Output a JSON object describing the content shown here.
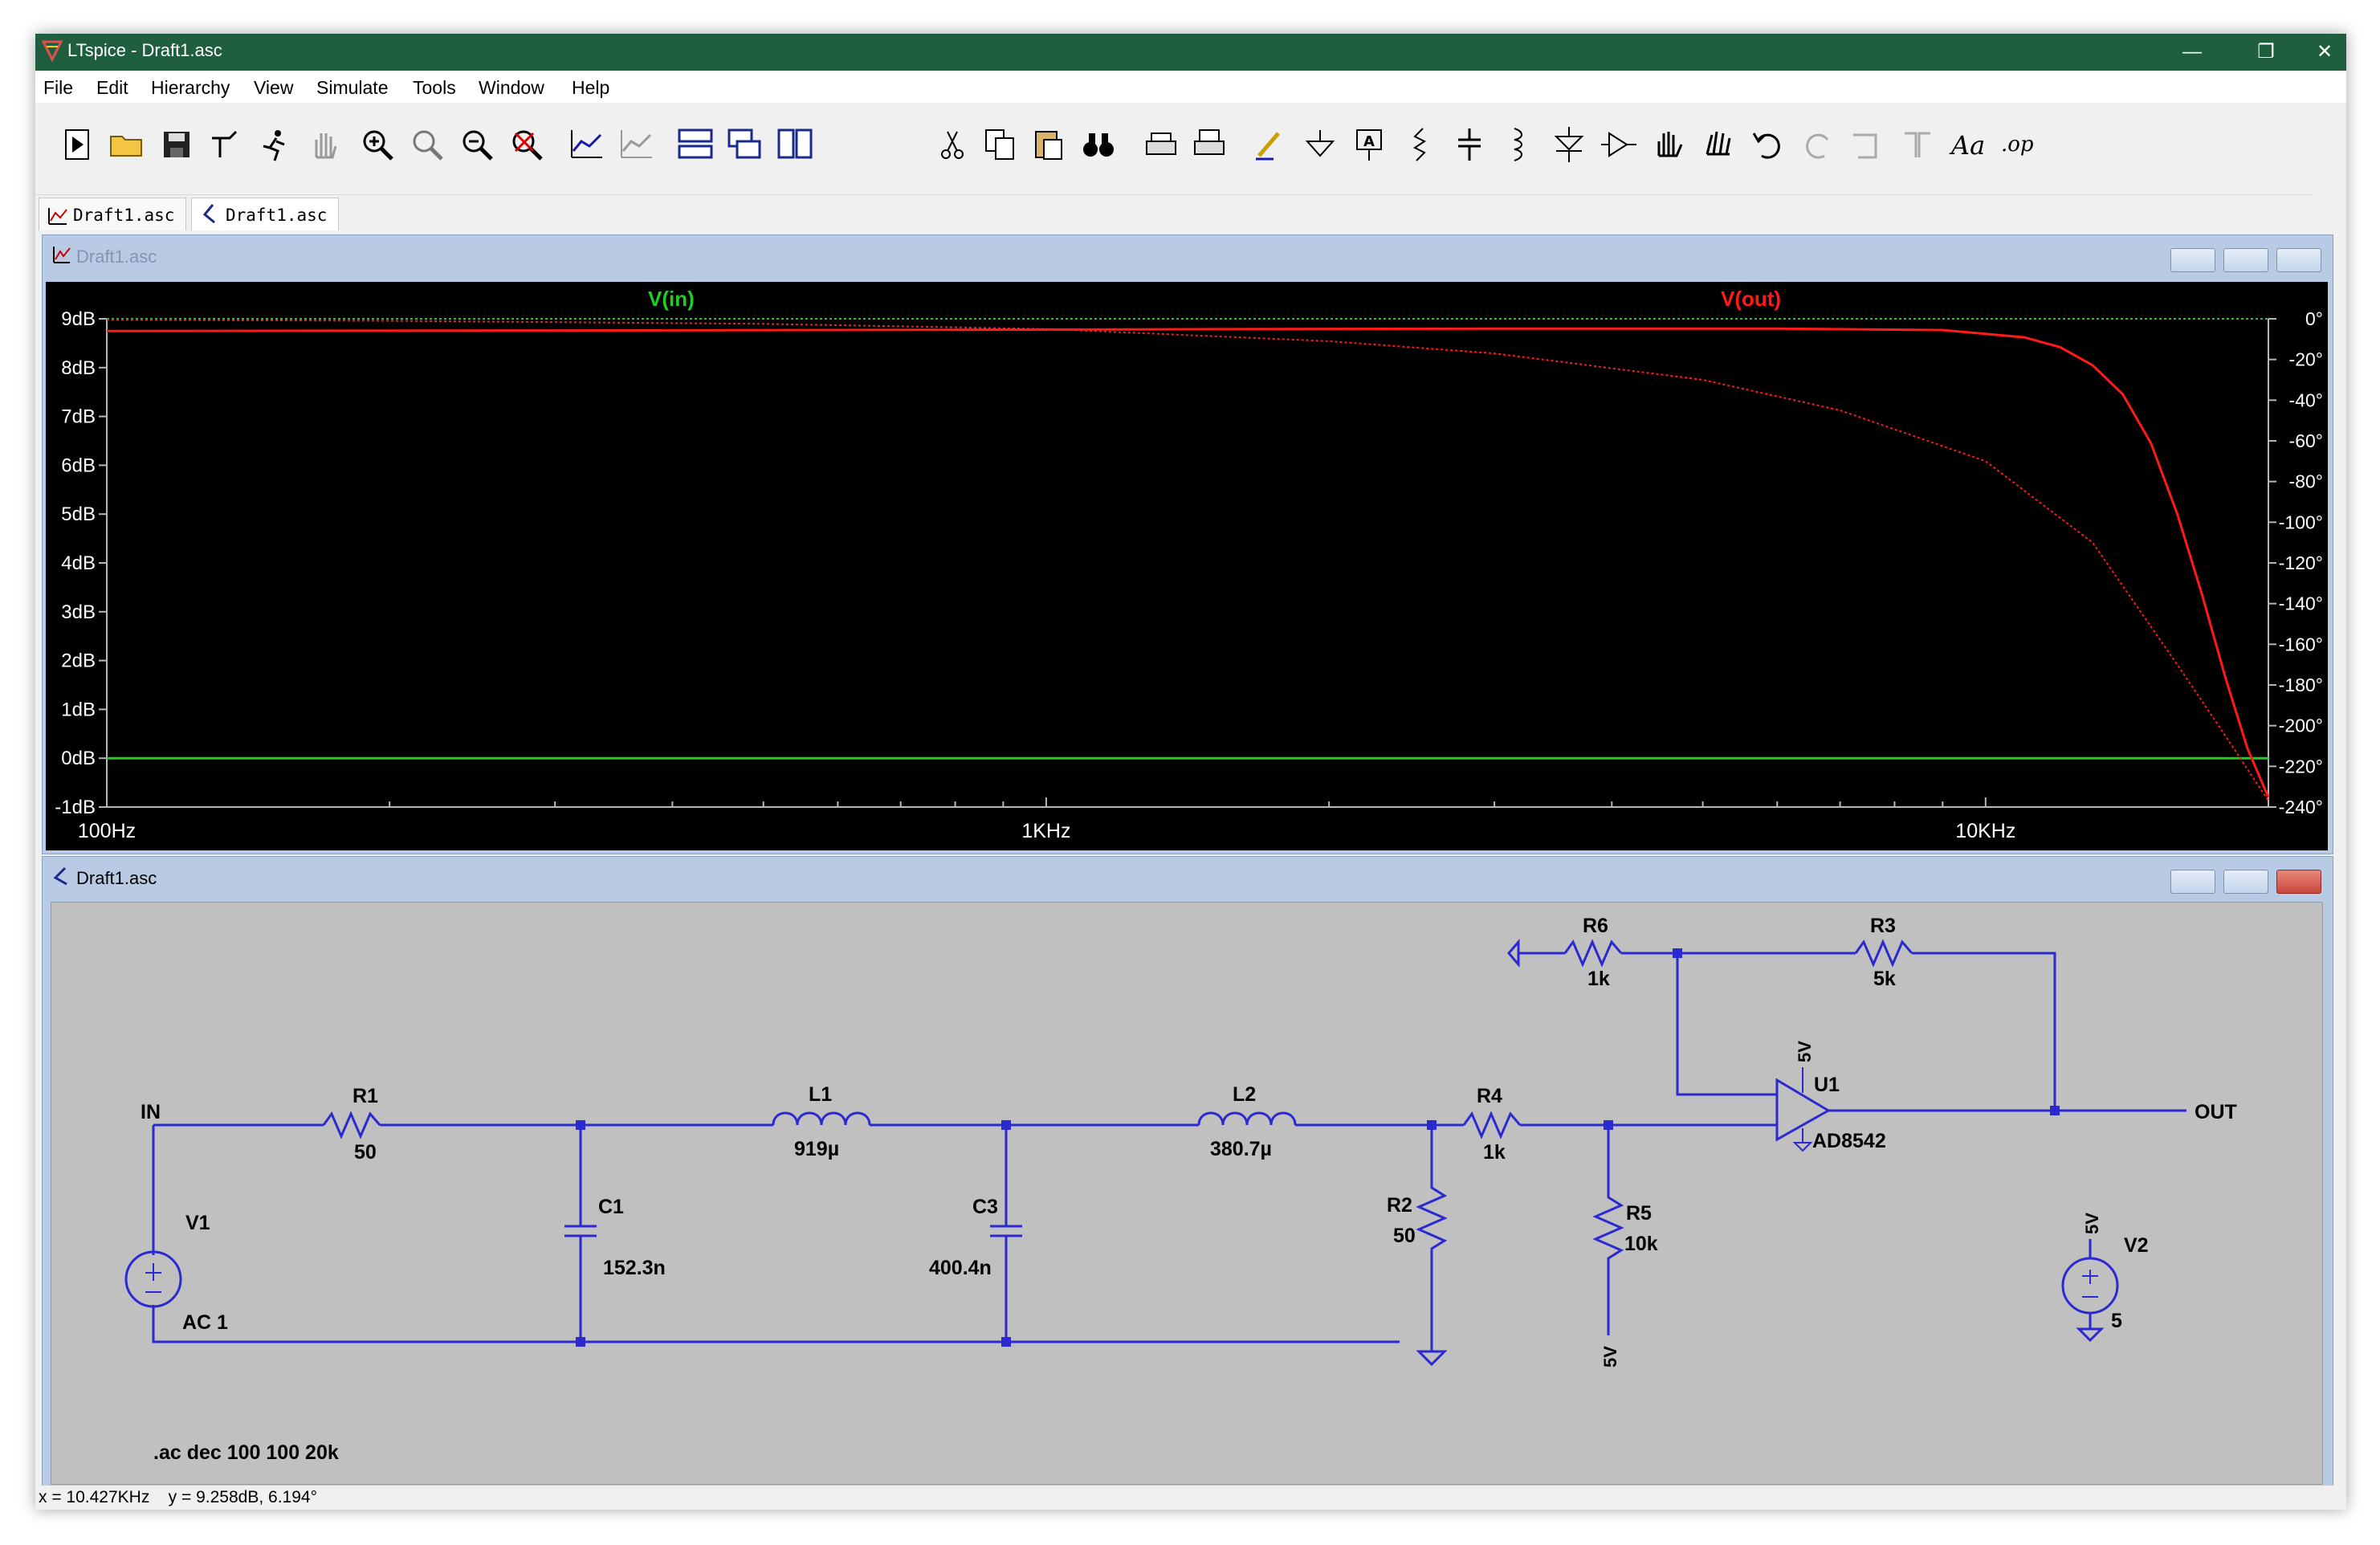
{
  "window": {
    "title": "LTspice - Draft1.asc"
  },
  "menu": [
    "File",
    "Edit",
    "Hierarchy",
    "View",
    "Simulate",
    "Tools",
    "Window",
    "Help"
  ],
  "tabs": [
    {
      "label": "Draft1.asc",
      "icon": "waveform-icon"
    },
    {
      "label": "Draft1.asc",
      "icon": "schematic-icon"
    }
  ],
  "plot_window": {
    "title": "Draft1.asc",
    "traces": [
      {
        "name": "V(in)",
        "color": "#22cc22"
      },
      {
        "name": "V(out)",
        "color": "#ff1a1a"
      }
    ],
    "y_left_ticks": [
      "9dB",
      "8dB",
      "7dB",
      "6dB",
      "5dB",
      "4dB",
      "3dB",
      "2dB",
      "1dB",
      "0dB",
      "-1dB"
    ],
    "y_right_ticks": [
      "0°",
      "-20°",
      "-40°",
      "-60°",
      "-80°",
      "-100°",
      "-120°",
      "-140°",
      "-160°",
      "-180°",
      "-200°",
      "-220°",
      "-240°"
    ],
    "x_ticks": [
      "100Hz",
      "1KHz",
      "10KHz"
    ]
  },
  "chart_data": {
    "type": "line",
    "title": "",
    "xlabel": "",
    "ylabel": "",
    "x_scale": "log",
    "xlim": [
      100,
      20000
    ],
    "ylim": [
      -1,
      9
    ],
    "ylim_right": [
      -240,
      0
    ],
    "legend": [
      "V(in)",
      "V(out)"
    ],
    "grid": false,
    "series": [
      {
        "name": "V(in)",
        "kind": "magnitude",
        "axis": "left",
        "color": "#22cc22",
        "x": [
          100,
          20000
        ],
        "y": [
          0,
          0
        ]
      },
      {
        "name": "V(in)",
        "kind": "phase",
        "axis": "right",
        "color": "#22cc22",
        "x": [
          100,
          20000
        ],
        "y": [
          0,
          0
        ]
      },
      {
        "name": "V(out)",
        "kind": "magnitude",
        "axis": "left",
        "color": "#ff1a1a",
        "x": [
          100,
          300,
          1000,
          3000,
          6000,
          9000,
          11000,
          12000,
          13000,
          14000,
          15000,
          16000,
          17000,
          18000,
          19000,
          20000
        ],
        "y": [
          8.75,
          8.76,
          8.78,
          8.8,
          8.8,
          8.77,
          8.62,
          8.42,
          8.05,
          7.45,
          6.45,
          5.0,
          3.35,
          1.65,
          0.2,
          -0.8
        ]
      },
      {
        "name": "V(out)",
        "kind": "phase",
        "axis": "right",
        "color": "#ff1a1a",
        "x": [
          100,
          200,
          500,
          1000,
          2000,
          3000,
          5000,
          7000,
          10000,
          13000,
          16000,
          18000,
          20000
        ],
        "y": [
          -0.5,
          -1,
          -2.5,
          -5,
          -11,
          -17,
          -30,
          -45,
          -70,
          -110,
          -170,
          -205,
          -237
        ]
      }
    ]
  },
  "schematic_window": {
    "title": "Draft1.asc",
    "components": [
      {
        "ref": "R1",
        "value": "50"
      },
      {
        "ref": "L1",
        "value": "919µ"
      },
      {
        "ref": "L2",
        "value": "380.7µ"
      },
      {
        "ref": "C1",
        "value": "152.3n"
      },
      {
        "ref": "C3",
        "value": "400.4n"
      },
      {
        "ref": "R2",
        "value": "50"
      },
      {
        "ref": "R4",
        "value": "1k"
      },
      {
        "ref": "R5",
        "value": "10k"
      },
      {
        "ref": "R6",
        "value": "1k"
      },
      {
        "ref": "R3",
        "value": "5k"
      },
      {
        "ref": "U1",
        "value": "AD8542"
      },
      {
        "ref": "V1",
        "value": "AC 1"
      },
      {
        "ref": "V2",
        "value": "5"
      }
    ],
    "nets": {
      "in": "IN",
      "out": "OUT",
      "supply": "5V"
    },
    "directive": ".ac dec 100 100 20k",
    "colors": {
      "wire": "#2a2ad0",
      "background": "#c0c0c0",
      "label": "#000000"
    }
  },
  "status": "x = 10.427KHz    y = 9.258dB, 6.194°"
}
